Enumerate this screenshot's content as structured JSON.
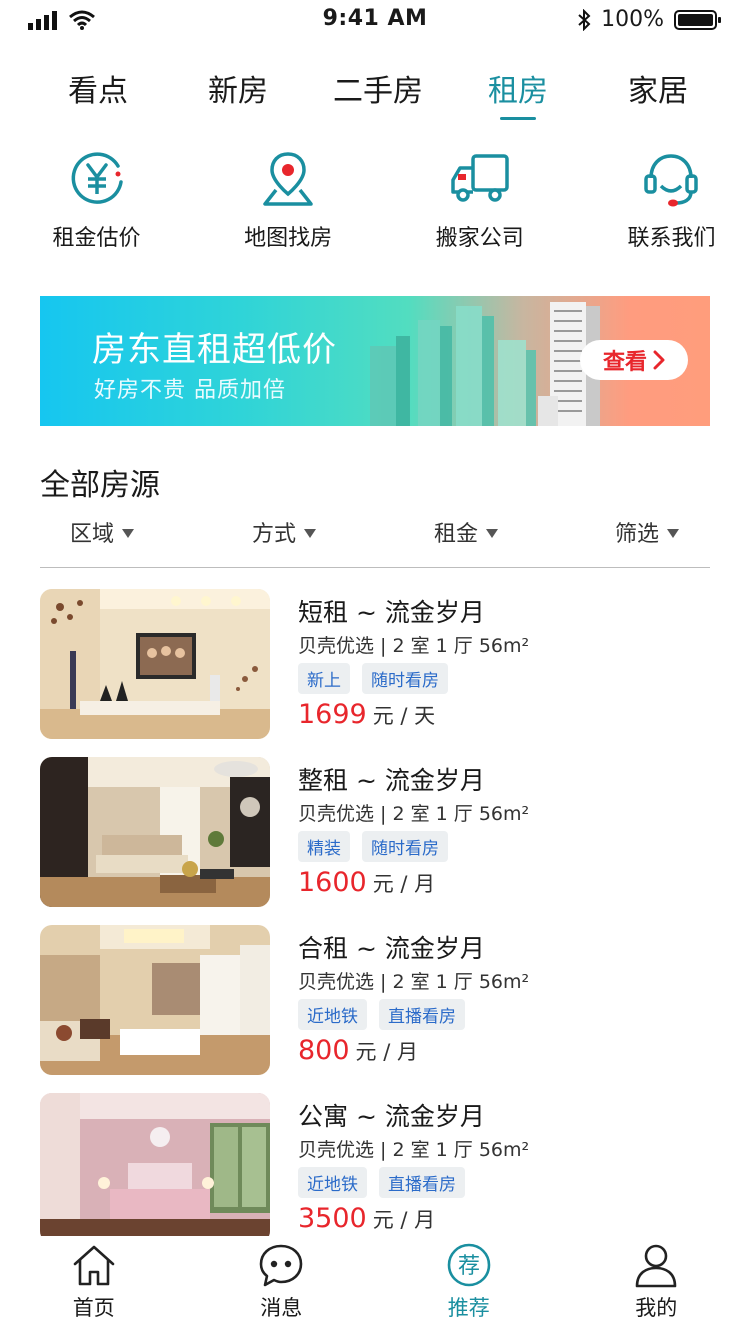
{
  "status_bar": {
    "time": "9:41 AM",
    "battery": "100%"
  },
  "top_tabs": [
    {
      "label": "看点"
    },
    {
      "label": "新房"
    },
    {
      "label": "二手房"
    },
    {
      "label": "租房"
    },
    {
      "label": "家居"
    }
  ],
  "active_tab": "租房",
  "quick_entries": [
    {
      "label": "租金估价",
      "icon": "yuan-coin-icon"
    },
    {
      "label": "地图找房",
      "icon": "map-pin-icon"
    },
    {
      "label": "搬家公司",
      "icon": "truck-icon"
    },
    {
      "label": "联系我们",
      "icon": "headset-icon"
    }
  ],
  "banner": {
    "title": "房东直租超低价",
    "subtitle": "好房不贵 品质加倍",
    "button": "查看"
  },
  "section": {
    "title": "全部房源"
  },
  "filters": [
    {
      "label": "区域"
    },
    {
      "label": "方式"
    },
    {
      "label": "租金"
    },
    {
      "label": "筛选"
    }
  ],
  "listings": [
    {
      "title": "短租 ~ 流金岁月",
      "meta": "贝壳优选 | 2 室 1 厅 56m²",
      "tags": [
        "新上",
        "随时看房"
      ],
      "price": "1699",
      "unit": "元 / 天"
    },
    {
      "title": "整租 ~ 流金岁月",
      "meta": "贝壳优选 | 2 室 1 厅 56m²",
      "tags": [
        "精装",
        "随时看房"
      ],
      "price": "1600",
      "unit": "元 / 月"
    },
    {
      "title": "合租 ~ 流金岁月",
      "meta": "贝壳优选 | 2 室 1 厅 56m²",
      "tags": [
        "近地铁",
        "直播看房"
      ],
      "price": "800",
      "unit": "元 / 月"
    },
    {
      "title": "公寓 ~ 流金岁月",
      "meta": "贝壳优选 | 2 室 1 厅 56m²",
      "tags": [
        "近地铁",
        "直播看房"
      ],
      "price": "3500",
      "unit": "元 / 月"
    }
  ],
  "bottom_nav": [
    {
      "label": "首页",
      "icon": "home-icon"
    },
    {
      "label": "消息",
      "icon": "message-icon"
    },
    {
      "label": "推荐",
      "icon": "recommend-icon",
      "glyph": "荐"
    },
    {
      "label": "我的",
      "icon": "user-icon"
    }
  ],
  "active_nav": "推荐",
  "colors": {
    "accent": "#1a8fa0",
    "price": "#e8262c",
    "tag_text": "#2b6bc9",
    "tag_bg": "#eceff1"
  }
}
